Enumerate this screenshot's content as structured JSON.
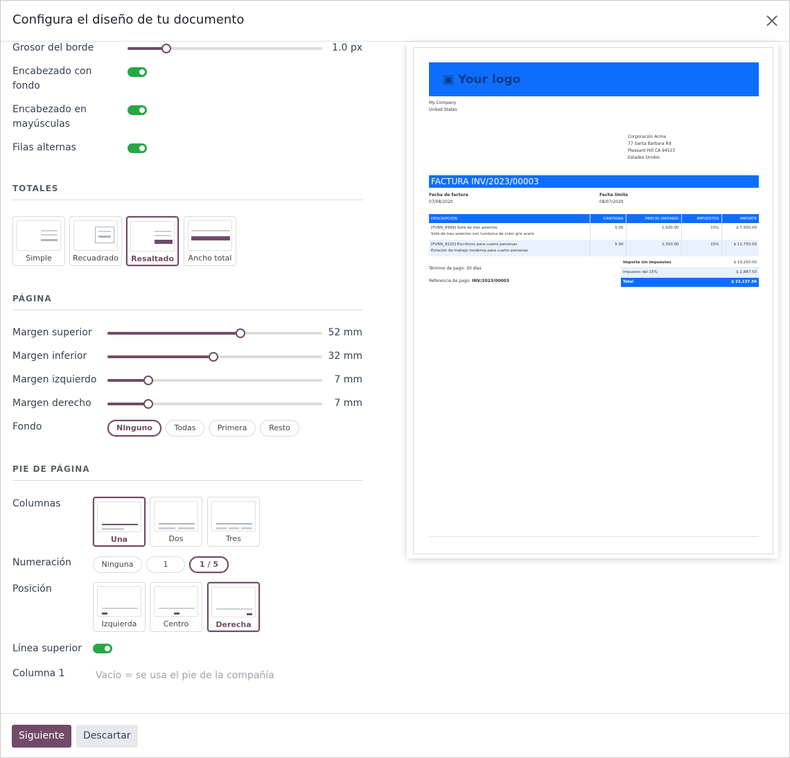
{
  "dialog": {
    "title": "Configura el diseño de tu documento",
    "close_icon": "close-icon"
  },
  "border": {
    "label": "Grosor del borde",
    "value": "1.0 px",
    "level": 0.2
  },
  "toggles": {
    "header_bg": {
      "label": "Encabezado con fondo",
      "on": true
    },
    "header_upper": {
      "label": "Encabezado en mayúsculas",
      "on": true
    },
    "alt_rows": {
      "label": "Filas alternas",
      "on": true
    }
  },
  "totals": {
    "heading": "TOTALES",
    "options": [
      "Simple",
      "Recuadrado",
      "Resaltado",
      "Ancho total"
    ],
    "selected": "Resaltado"
  },
  "page": {
    "heading": "PÁGINA",
    "margins": [
      {
        "label": "Margen superior",
        "value": "52 mm",
        "level": 0.62
      },
      {
        "label": "Margen inferior",
        "value": "32 mm",
        "level": 0.495
      },
      {
        "label": "Margen izquierdo",
        "value": "7 mm",
        "level": 0.19
      },
      {
        "label": "Margen derecho",
        "value": "7 mm",
        "level": 0.19
      }
    ],
    "background": {
      "label": "Fondo",
      "options": [
        "Ninguno",
        "Todas",
        "Primera",
        "Resto"
      ],
      "selected": "Ninguno"
    }
  },
  "footer_section": {
    "heading": "PIE DE PÁGINA",
    "columns": {
      "label": "Columnas",
      "options": [
        "Una",
        "Dos",
        "Tres"
      ],
      "selected": "Una"
    },
    "numbering": {
      "label": "Numeración",
      "options": [
        "Ninguna",
        "1",
        "1 / 5"
      ],
      "selected": "1 / 5"
    },
    "position": {
      "label": "Posición",
      "options": [
        "Izquierda",
        "Centro",
        "Derecha"
      ],
      "selected": "Derecha"
    },
    "top_line": {
      "label": "Línea superior",
      "on": true
    },
    "column1": {
      "label": "Columna 1",
      "placeholder": "Vacío = se usa el pie de la compañía"
    }
  },
  "buttons": {
    "next": "Siguiente",
    "discard": "Descartar"
  },
  "colors": {
    "accent": "#714B67",
    "toggle": "#28a745",
    "preview_brand": "#0d6efd"
  },
  "preview": {
    "logo": "Your logo",
    "company": [
      "My Company",
      "United States"
    ],
    "customer": [
      "Corporación Acme",
      "77 Santa Barbara Rd",
      "Pleasant Hill CA 94523",
      "Estados Unidos"
    ],
    "invoice_title": "FACTURA INV/2023/00003",
    "invoice_date_label": "Fecha de factura",
    "invoice_date": "07/08/2020",
    "due_date_label": "Fecha límite",
    "due_date": "08/07/2020",
    "table_headers": [
      "DESCRIPCIÓN",
      "CANTIDAD",
      "PRECIO UNITARIO",
      "IMPUESTOS",
      "IMPORTE"
    ],
    "rows": [
      {
        "desc1": "[FURN_8999] Sofá de tres asientos",
        "desc2": "Sofá de tres asientos con tumbona de color gris acero",
        "qty": "5.00",
        "price": "1,500.00",
        "tax": "15%",
        "amount": "$ 7,500.00"
      },
      {
        "desc1": "[FURN_8220] Escritorio para cuatro personas",
        "desc2": "Estación de trabajo moderna para cuatro personas",
        "qty": "5.00",
        "price": "2,350.00",
        "tax": "15%",
        "amount": "$ 11,750.00"
      }
    ],
    "payment_terms": "Término de pago: 30 días",
    "reference_label": "Referencia de pago:",
    "reference": "INV/2023/00003",
    "totals": [
      {
        "label": "Importe sin impuestos",
        "value": "$ 19,250.00"
      },
      {
        "label": "Impuesto del 15%",
        "value": "$ 2,887.50"
      },
      {
        "label": "Total",
        "value": "$ 22,137.50"
      }
    ]
  }
}
